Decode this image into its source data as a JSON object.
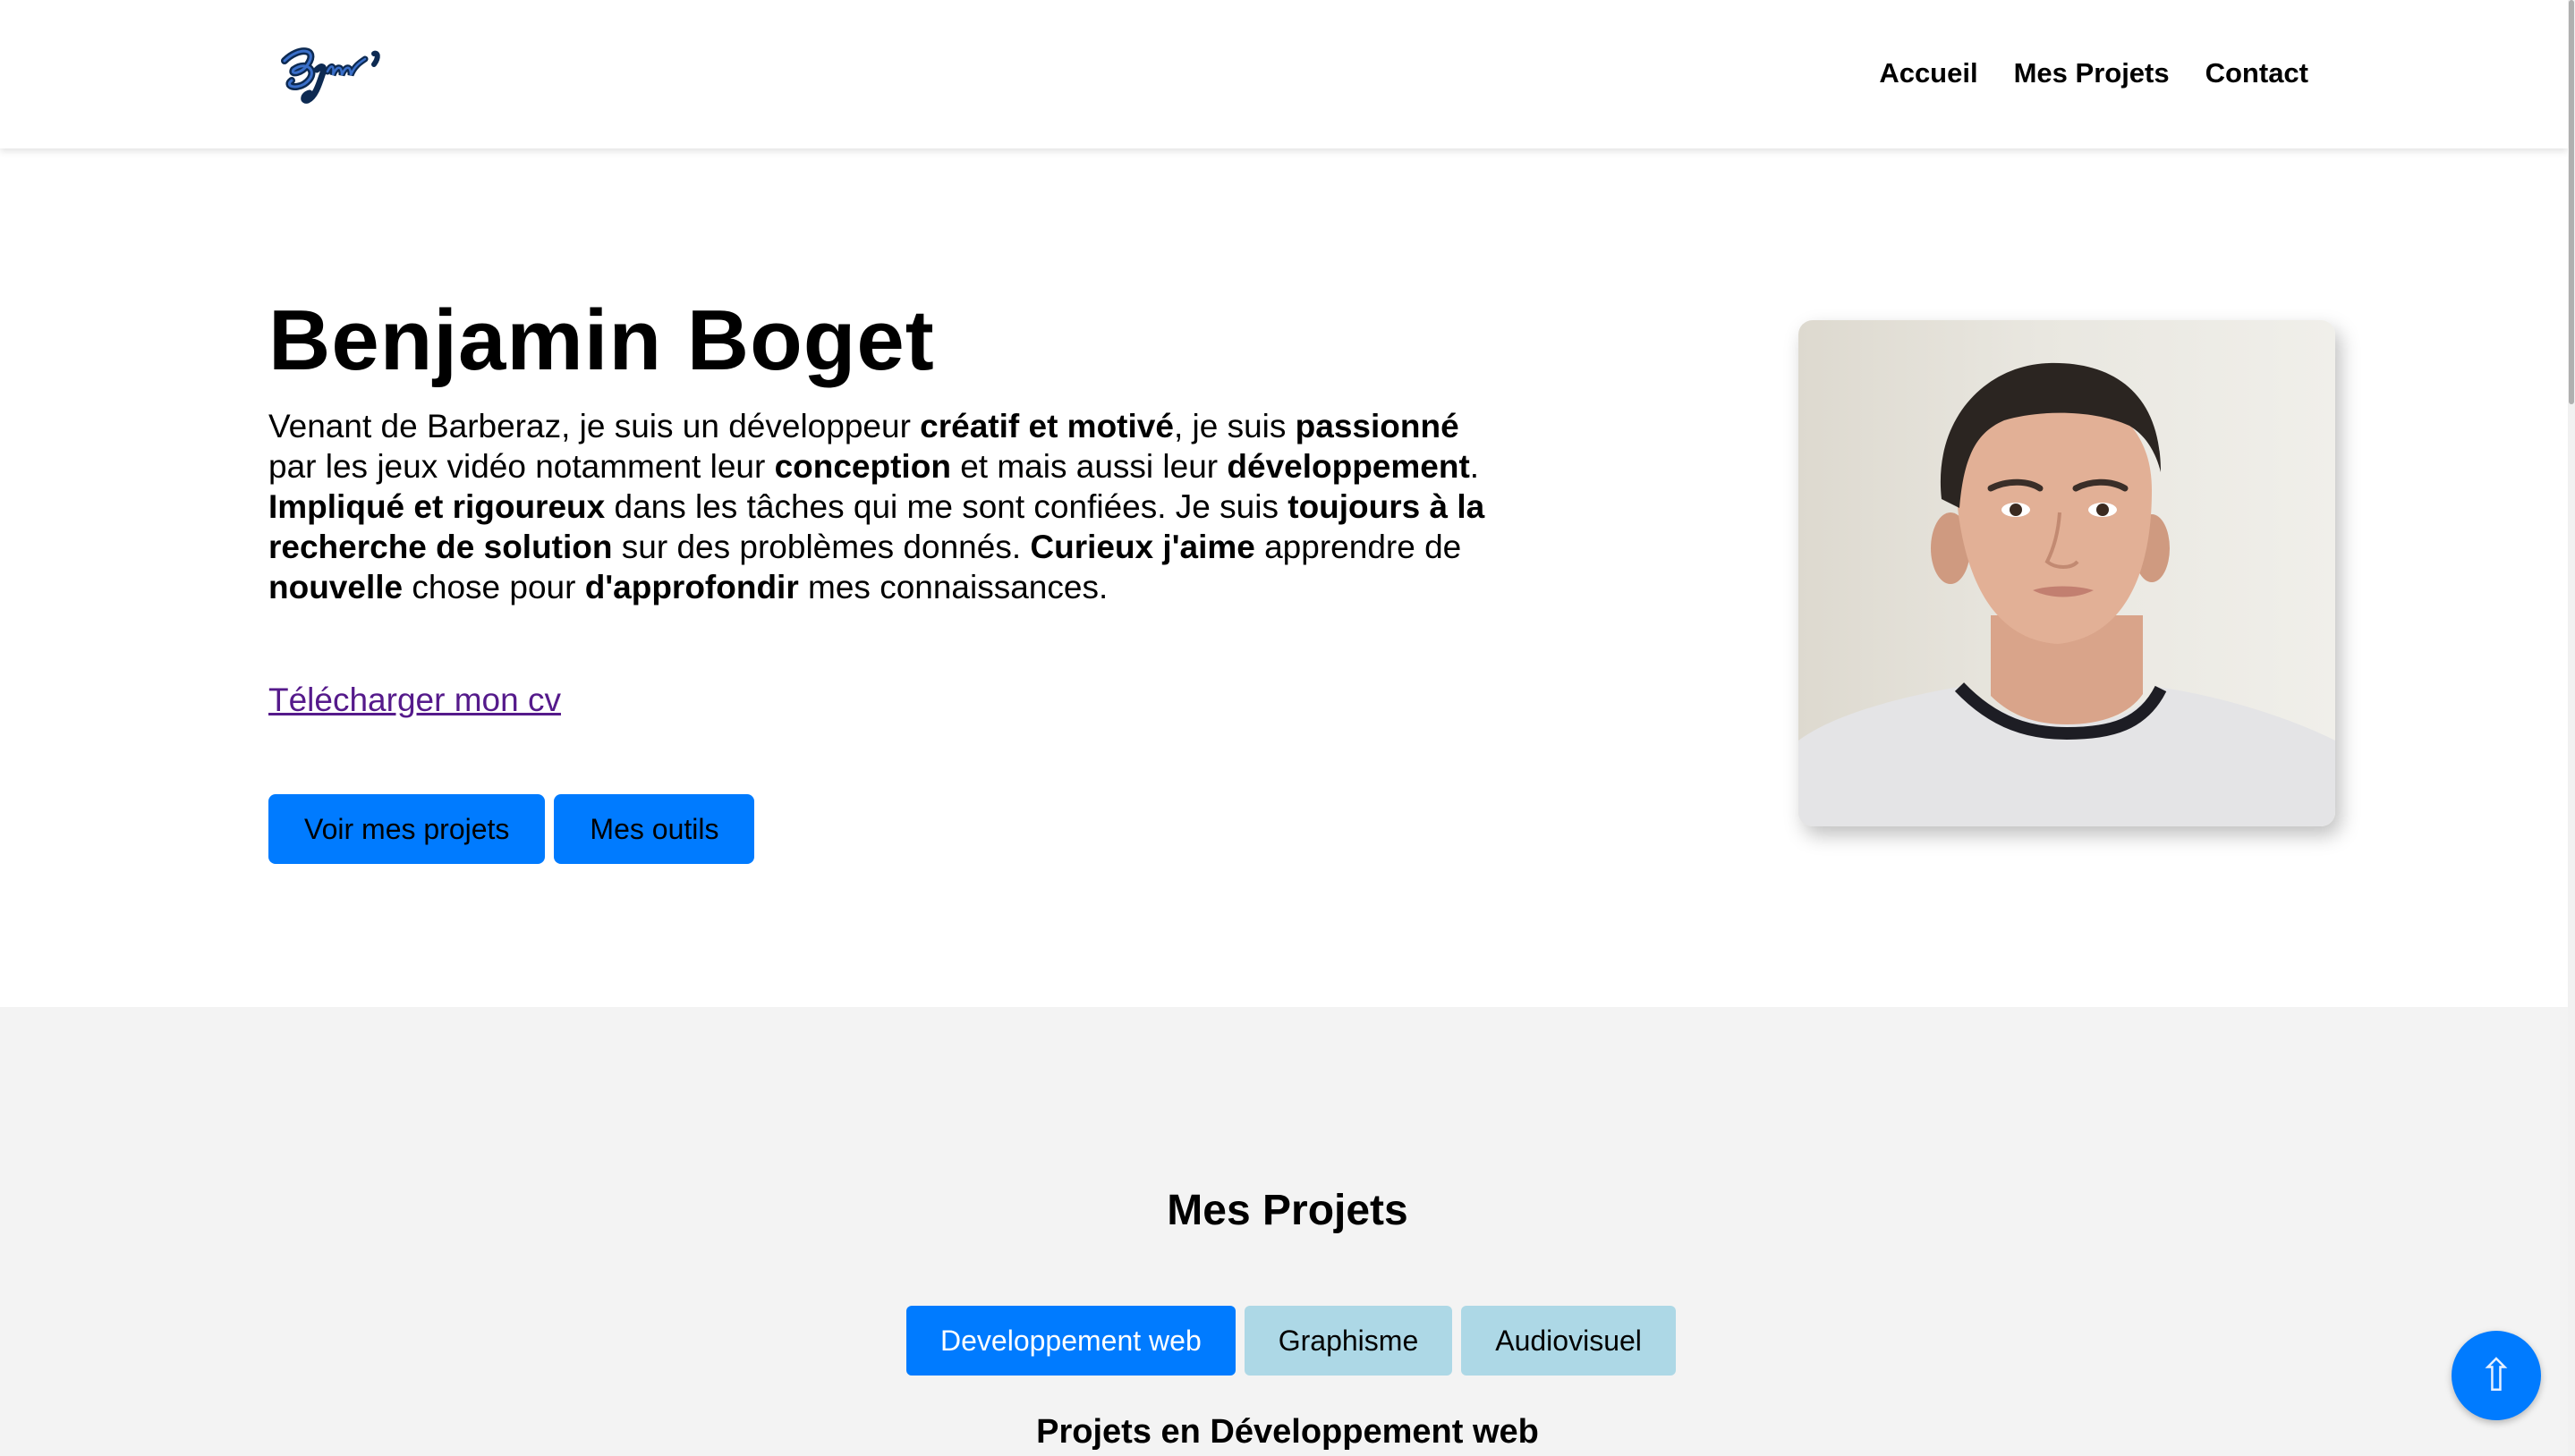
{
  "header": {
    "logo_icon": "signature-logo-icon",
    "nav": [
      {
        "label": "Accueil"
      },
      {
        "label": "Mes Projets"
      },
      {
        "label": "Contact"
      }
    ]
  },
  "hero": {
    "name": "Benjamin Boget",
    "bio": {
      "s1": "Venant de Barberaz, je suis un développeur ",
      "b1": "créatif et motivé",
      "s2": ", je suis ",
      "b2": "passionné",
      "s3": " par les jeux vidéo notamment leur ",
      "b3": "conception",
      "s4": " et mais aussi leur ",
      "b4": "développement",
      "s5": ". ",
      "b5": "Impliqué et rigoureux",
      "s6": " dans les tâches qui me sont confiées. Je suis ",
      "b6": "toujours à la recherche de solution",
      "s7": " sur des problèmes donnés. ",
      "b7": "Curieux j'aime",
      "s8": " apprendre de ",
      "b8": "nouvelle",
      "s9": " chose pour ",
      "b9": "d'approfondir",
      "s10": " mes connaissances."
    },
    "cv_link": "Télécharger mon cv",
    "buttons": {
      "projects": "Voir mes projets",
      "tools": "Mes outils"
    },
    "photo_icon": "portrait-photo"
  },
  "projects": {
    "title": "Mes Projets",
    "tabs": [
      {
        "label": "Developpement web",
        "active": true
      },
      {
        "label": "Graphisme",
        "active": false
      },
      {
        "label": "Audiovisuel",
        "active": false
      }
    ],
    "subtitle": "Projets en Développement web"
  },
  "back_to_top": {
    "icon": "arrow-up-icon",
    "glyph": "⇧"
  },
  "colors": {
    "primary": "#007bff",
    "tab_inactive": "#add8e6",
    "section_bg": "#f3f3f3",
    "link_visited": "#551a8b"
  }
}
